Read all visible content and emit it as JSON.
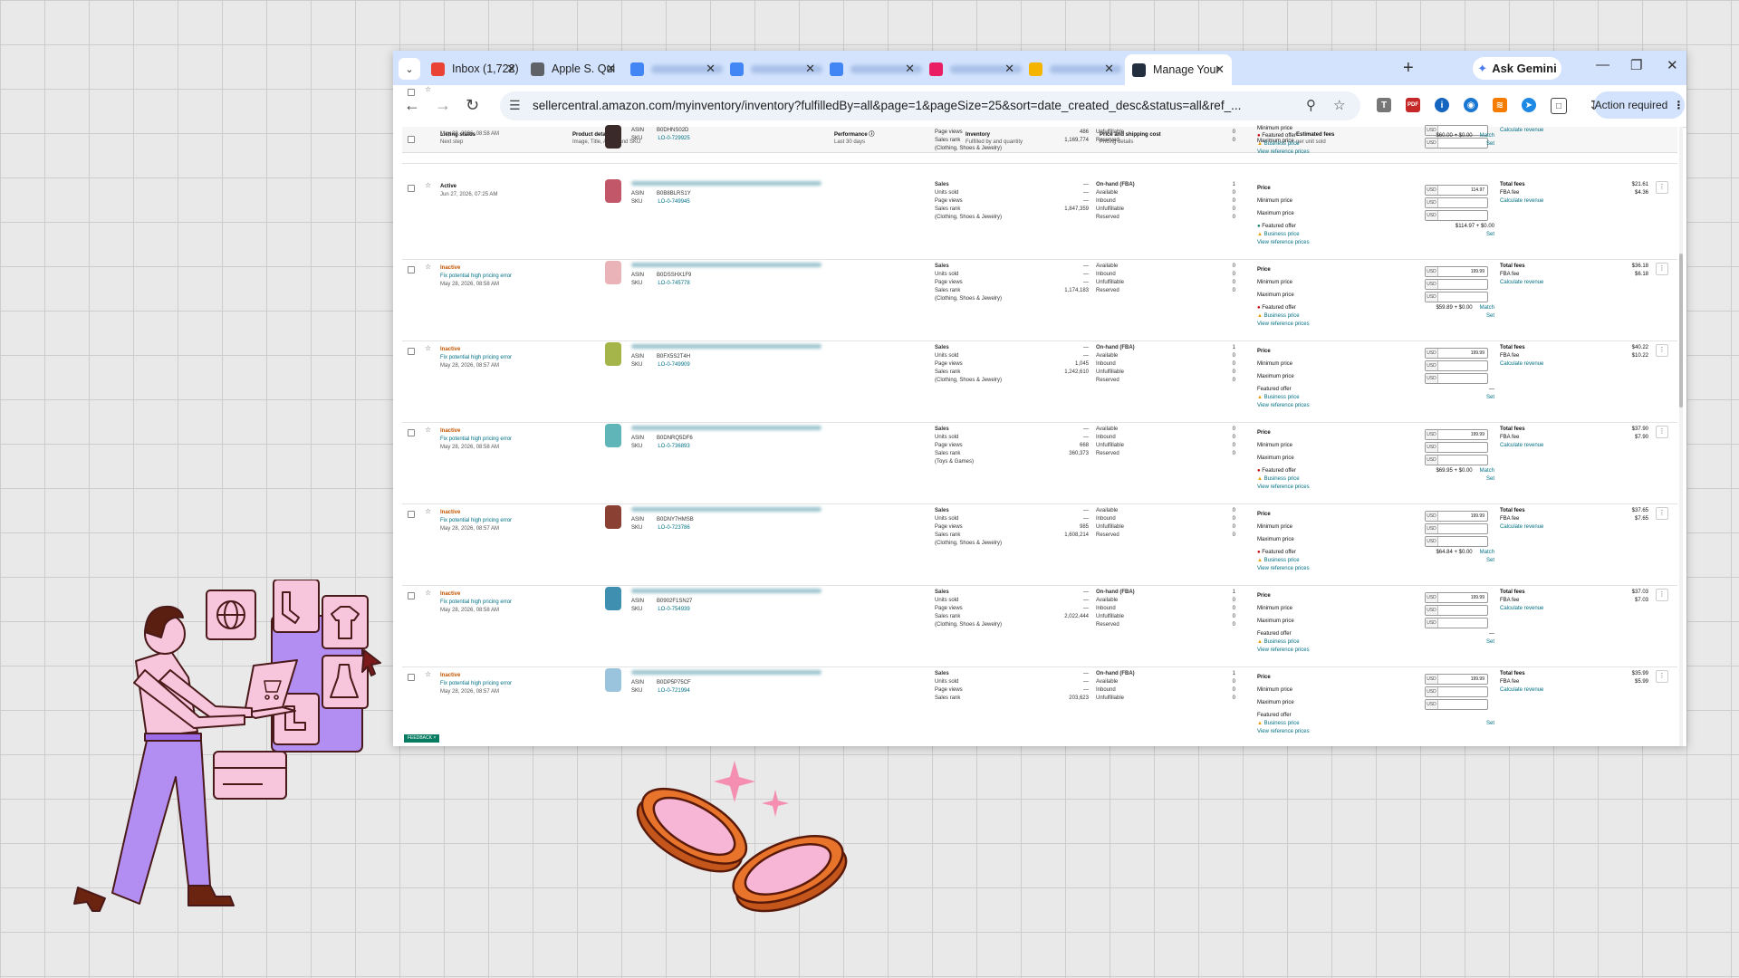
{
  "browser": {
    "tabs": [
      {
        "title": "Inbox (1,722)",
        "favicon_color": "#ea4335",
        "blurred": false
      },
      {
        "title": "Apple S. Qui",
        "favicon_color": "#5f6368",
        "blurred": false
      },
      {
        "title": "",
        "favicon_color": "#4285f4",
        "blurred": true
      },
      {
        "title": "",
        "favicon_color": "#4285f4",
        "blurred": true
      },
      {
        "title": "",
        "favicon_color": "#4285f4",
        "blurred": true
      },
      {
        "title": "",
        "favicon_color": "#e91e63",
        "blurred": true
      },
      {
        "title": "",
        "favicon_color": "#f4b400",
        "blurred": true
      },
      {
        "title": "Manage Your",
        "favicon_color": "#232f3e",
        "blurred": false,
        "active": true
      }
    ],
    "gemini_label": "Ask Gemini",
    "url": "sellercentral.amazon.com/myinventory/inventory?fulfilledBy=all&page=1&pageSize=25&sort=date_created_desc&status=all&ref_...",
    "action_required": "Action required",
    "ext_labels": {
      "t": "T",
      "pdf": "PDF"
    }
  },
  "table": {
    "headers": [
      {
        "title": "Listing status",
        "sub": "Next step"
      },
      {
        "title": "Product details",
        "sub": "Image, Title, ASIN, and SKU"
      },
      {
        "title": "Performance ⓘ",
        "sub": "Last 30 days"
      },
      {
        "title": "Inventory",
        "sub": "Fulfilled by and quantity"
      },
      {
        "title": "Price and shipping cost",
        "sub": "Pricing details"
      },
      {
        "title": "Estimated fees",
        "sub": "per unit sold"
      }
    ],
    "labels": {
      "asin": "ASIN",
      "sku": "SKU",
      "sales": "Sales",
      "units_sold": "Units sold",
      "page_views": "Page views",
      "sales_rank": "Sales rank",
      "on_hand": "On-hand (FBA)",
      "available": "Available",
      "inbound": "Inbound",
      "unfulfillable": "Unfulfillable",
      "reserved": "Reserved",
      "price": "Price",
      "min_price": "Minimum price",
      "max_price": "Maximum price",
      "usd": "USD",
      "featured_offer": "Featured offer",
      "business_price": "Business price",
      "view_ref": "View reference prices",
      "match": "Match",
      "set": "Set",
      "total_fees": "Total fees",
      "fba_fee": "FBA fee",
      "calc": "Calculate revenue",
      "fix_error": "Fix potential high pricing error",
      "feedback": "FEEDBACK"
    },
    "rows": [
      {
        "status": "",
        "date": "May 28, 2026, 08:58 AM",
        "asin": "B0DHNS02D",
        "sku": "LO-0-729925",
        "thumb": "#3a2a2a",
        "page_views": "486",
        "sales_rank": "1,169,774",
        "category": "(Clothing, Shoes & Jewelry)",
        "inv_on_hand": false,
        "inv": [
          "0",
          "0"
        ],
        "price": "",
        "featured": "bad",
        "offer_value": "$60.00 + $0.00",
        "fees_total": "",
        "fees_fba": ""
      },
      {
        "status": "Active",
        "date": "Jun 27, 2026, 07:25 AM",
        "asin": "B0B8BLRS1Y",
        "sku": "LO-0-749945",
        "thumb": "#c2576a",
        "sales": "—",
        "units_sold": "—",
        "page_views": "—",
        "sales_rank": "1,847,359",
        "category": "(Clothing, Shoes & Jewelry)",
        "inv_on_hand": true,
        "inv": [
          "1",
          "0",
          "0",
          "0",
          "0"
        ],
        "price": "114.97",
        "featured": "good",
        "offer_value": "$114.97 + $0.00",
        "fees_total": "$21.61",
        "fees_fba": "$4.36"
      },
      {
        "status": "Inactive",
        "date": "May 28, 2026, 08:58 AM",
        "asin": "B0DSSHX1F9",
        "sku": "LO-0-745778",
        "thumb": "#eab3b8",
        "sales": "—",
        "units_sold": "—",
        "page_views": "—",
        "sales_rank": "1,174,183",
        "category": "(Clothing, Shoes & Jewelry)",
        "inv_on_hand": false,
        "inv": [
          "0",
          "0",
          "0",
          "0"
        ],
        "price": "199.99",
        "featured": "bad",
        "offer_value": "$59.89 + $0.00",
        "fees_total": "$36.18",
        "fees_fba": "$6.18"
      },
      {
        "status": "Inactive",
        "date": "May 28, 2026, 08:57 AM",
        "asin": "B0FX5S2T4H",
        "sku": "LO-0-749909",
        "thumb": "#a5b54a",
        "sales": "—",
        "units_sold": "—",
        "page_views": "1,045",
        "sales_rank": "1,242,610",
        "category": "(Clothing, Shoes & Jewelry)",
        "inv_on_hand": true,
        "inv": [
          "1",
          "0",
          "0",
          "0",
          "0"
        ],
        "price": "199.99",
        "featured": "none",
        "offer_value": "—",
        "fees_total": "$40.22",
        "fees_fba": "$10.22"
      },
      {
        "status": "Inactive",
        "date": "May 28, 2026, 08:58 AM",
        "asin": "B0DNRQ5DF6",
        "sku": "LO-0-736893",
        "thumb": "#5fb5b8",
        "sales": "—",
        "units_sold": "—",
        "page_views": "668",
        "sales_rank": "360,373",
        "category": "(Toys & Games)",
        "inv_on_hand": false,
        "inv": [
          "0",
          "0",
          "0",
          "0"
        ],
        "price": "199.99",
        "featured": "bad",
        "offer_value": "$69.95 + $0.00",
        "fees_total": "$37.90",
        "fees_fba": "$7.90"
      },
      {
        "status": "Inactive",
        "date": "May 28, 2026, 08:57 AM",
        "asin": "B0DNY7HMSB",
        "sku": "LO-0-723786",
        "thumb": "#8a4032",
        "sales": "—",
        "units_sold": "—",
        "page_views": "985",
        "sales_rank": "1,608,214",
        "category": "(Clothing, Shoes & Jewelry)",
        "inv_on_hand": false,
        "inv": [
          "0",
          "0",
          "0",
          "0"
        ],
        "price": "199.99",
        "featured": "bad",
        "offer_value": "$64.84 + $0.00",
        "fees_total": "$37.65",
        "fees_fba": "$7.65"
      },
      {
        "status": "Inactive",
        "date": "May 28, 2026, 08:58 AM",
        "asin": "B0902F1SN27",
        "sku": "LO-0-754939",
        "thumb": "#3e8fb0",
        "sales": "—",
        "units_sold": "—",
        "page_views": "—",
        "sales_rank": "2,022,444",
        "category": "(Clothing, Shoes & Jewelry)",
        "inv_on_hand": true,
        "inv": [
          "1",
          "0",
          "0",
          "0",
          "0"
        ],
        "price": "199.99",
        "featured": "none",
        "offer_value": "—",
        "fees_total": "$37.03",
        "fees_fba": "$7.03"
      },
      {
        "status": "Inactive",
        "date": "May 28, 2026, 08:57 AM",
        "asin": "B0DP5P75CF",
        "sku": "LO-0-721994",
        "thumb": "#9ac4dd",
        "sales": "—",
        "units_sold": "—",
        "page_views": "—",
        "sales_rank": "203,623",
        "category": "",
        "inv_on_hand": true,
        "inv": [
          "1",
          "0",
          "0",
          "0"
        ],
        "price": "199.99",
        "featured": "none",
        "offer_value": "",
        "fees_total": "$35.99",
        "fees_fba": "$5.99"
      }
    ]
  }
}
